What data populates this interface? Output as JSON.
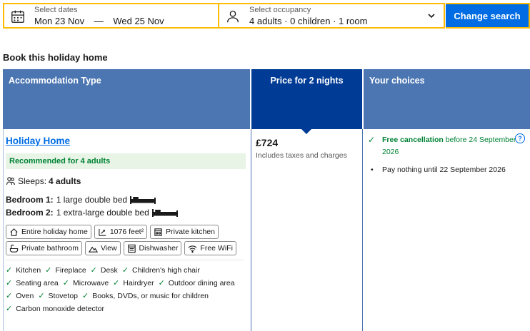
{
  "search": {
    "dates_label": "Select dates",
    "checkin": "Mon 23 Nov",
    "separator": "—",
    "checkout": "Wed 25 Nov",
    "occupancy_label": "Select occupancy",
    "occupancy_value": "4 adults · 0 children · 1 room",
    "button_label": "Change search"
  },
  "section_title": "Book this holiday home",
  "table": {
    "headers": {
      "type": "Accommodation Type",
      "price": "Price for 2 nights",
      "choices": "Your choices"
    },
    "room": {
      "name": "Holiday Home",
      "recommended": "Recommended for 4 adults",
      "sleeps_label": "Sleeps:",
      "sleeps_value": "4 adults",
      "bedrooms": [
        {
          "label": "Bedroom 1:",
          "value": "1 large double bed"
        },
        {
          "label": "Bedroom 2:",
          "value": "1 extra-large double bed"
        }
      ],
      "facilities": [
        {
          "label": "Entire holiday home",
          "icon": "home-icon"
        },
        {
          "label": "1076 feet²",
          "icon": "area-icon"
        },
        {
          "label": "Private kitchen",
          "icon": "kitchen-icon"
        },
        {
          "label": "Private bathroom",
          "icon": "bath-icon"
        },
        {
          "label": "View",
          "icon": "mountain-icon"
        },
        {
          "label": "Dishwasher",
          "icon": "dishwasher-icon"
        },
        {
          "label": "Free WiFi",
          "icon": "wifi-icon"
        }
      ],
      "amenities": [
        "Kitchen",
        "Fireplace",
        "Desk",
        "Children's high chair",
        "Seating area",
        "Microwave",
        "Hairdryer",
        "Outdoor dining area",
        "Oven",
        "Stovetop",
        "Books, DVDs, or music for children",
        "Carbon monoxide detector"
      ]
    },
    "price": {
      "amount": "£724",
      "note": "Includes taxes and charges"
    },
    "choices": {
      "cancel_strong": "Free cancellation",
      "cancel_rest": " before 24 September 2026",
      "pay_note": "Pay nothing until 22 September 2026"
    }
  },
  "colors": {
    "accent_blue": "#006ce4",
    "header_blue": "#4c76b2",
    "header_dark": "#003b95",
    "green": "#008234",
    "yellow_border": "#febb02"
  }
}
